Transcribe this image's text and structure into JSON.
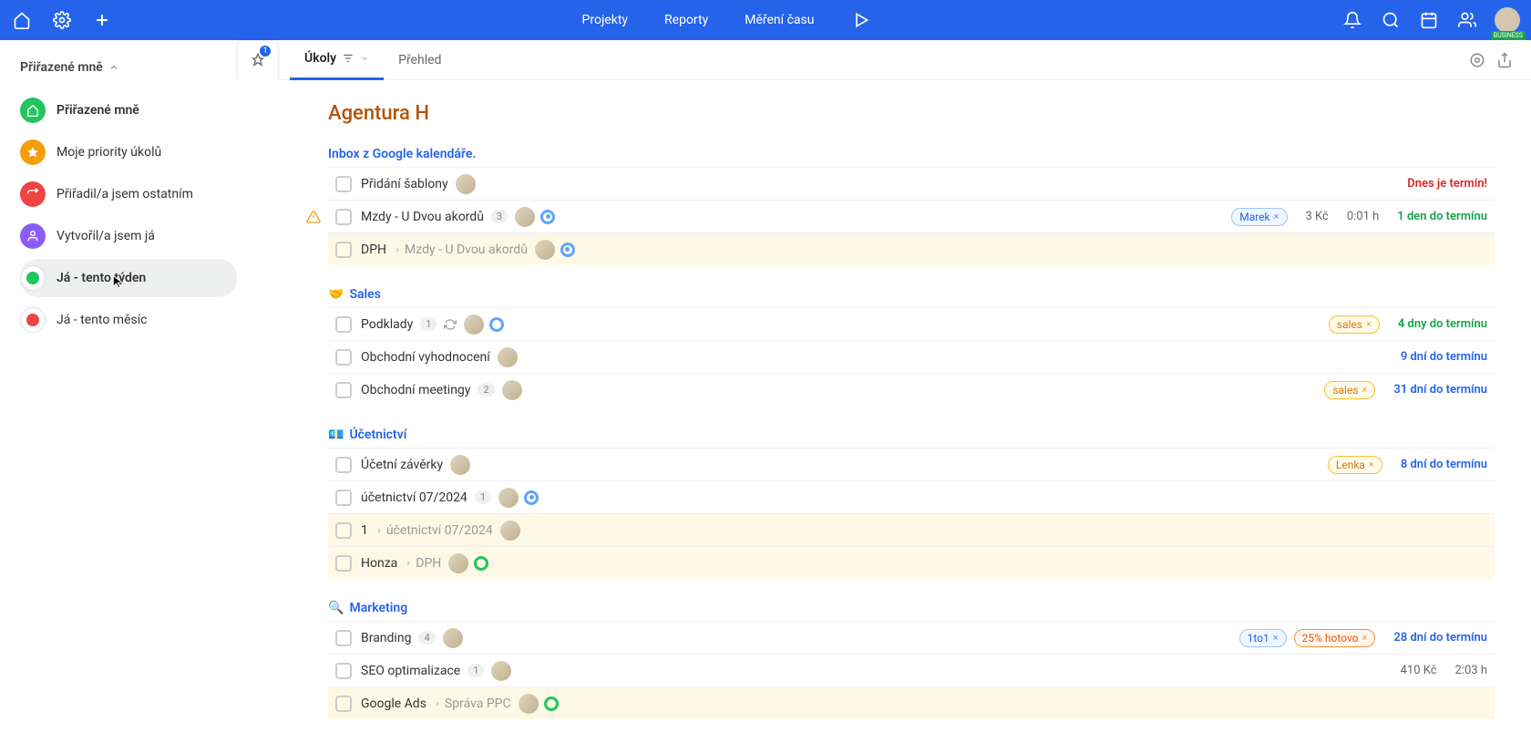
{
  "topbar": {
    "nav": {
      "projekty": "Projekty",
      "reporty": "Reporty",
      "mereni": "Měření času"
    },
    "badge": "BUSINESS"
  },
  "sidebar": {
    "header": "Přiřazené mně",
    "items": [
      {
        "label": "Přiřazené mně"
      },
      {
        "label": "Moje priority úkolů"
      },
      {
        "label": "Přiřadil/a jsem ostatním"
      },
      {
        "label": "Vytvořil/a jsem já"
      },
      {
        "label": "Já - tento týden"
      },
      {
        "label": "Já - tento měsíc"
      }
    ]
  },
  "tabs": {
    "pinCount": "1",
    "ukoly": "Úkoly",
    "prehled": "Přehled"
  },
  "project": {
    "title": "Agentura H"
  },
  "sections": [
    {
      "title": "Inbox z Google kalendáře.",
      "emoji": "",
      "tasks": [
        {
          "name": "Přidání šablony",
          "due": "Dnes je termín!",
          "dueClass": "red",
          "avatar": true
        },
        {
          "name": "Mzdy - U Dvou akordů",
          "count": "3",
          "avatar": true,
          "ringDot": true,
          "warn": true,
          "tags": [
            {
              "text": "Marek",
              "cls": "marek"
            }
          ],
          "meta1": "3 Kč",
          "meta2": "0:01 h",
          "due": "1 den do termínu",
          "dueClass": "green"
        },
        {
          "name": "DPH",
          "breadcrumb": "Mzdy - U Dvou akordů",
          "avatar": true,
          "ringDot": true,
          "highlight": true
        }
      ]
    },
    {
      "title": "Sales",
      "emoji": "🤝",
      "tasks": [
        {
          "name": "Podklady",
          "count": "1",
          "refresh": true,
          "avatar": true,
          "ring": true,
          "tags": [
            {
              "text": "sales",
              "cls": "sales"
            }
          ],
          "due": "4 dny do termínu",
          "dueClass": "green"
        },
        {
          "name": "Obchodní vyhodnocení",
          "avatar": true,
          "due": "9 dní do termínu",
          "dueClass": "blue"
        },
        {
          "name": "Obchodní meetingy",
          "count": "2",
          "avatar": true,
          "tags": [
            {
              "text": "sales",
              "cls": "sales"
            }
          ],
          "due": "31 dní do termínu",
          "dueClass": "blue"
        }
      ]
    },
    {
      "title": "Účetnictví",
      "emoji": "💶",
      "tasks": [
        {
          "name": "Účetní závěrky",
          "avatar": true,
          "tags": [
            {
              "text": "Lenka",
              "cls": "lenka"
            }
          ],
          "due": "8 dní do termínu",
          "dueClass": "blue"
        },
        {
          "name": "účetnictví 07/2024",
          "count": "1",
          "avatar": true,
          "ringDot": true
        },
        {
          "name": "1",
          "breadcrumb": "účetnictví 07/2024",
          "avatar": true,
          "highlight": true
        },
        {
          "name": "Honza",
          "breadcrumb": "DPH",
          "avatar": true,
          "ringGreen": true,
          "highlight": true
        }
      ]
    },
    {
      "title": "Marketing",
      "emoji": "🔍",
      "tasks": [
        {
          "name": "Branding",
          "count": "4",
          "avatar": true,
          "tags": [
            {
              "text": "1to1",
              "cls": "oneToOne"
            },
            {
              "text": "25% hotovo",
              "cls": "progress"
            }
          ],
          "due": "28 dní do termínu",
          "dueClass": "blue"
        },
        {
          "name": "SEO optimalizace",
          "count": "1",
          "avatar": true,
          "meta1": "410 Kč",
          "meta2": "2:03 h"
        },
        {
          "name": "Google Ads",
          "breadcrumb": "Správa PPC",
          "avatar": true,
          "ringGreen": true,
          "highlight": true
        }
      ]
    }
  ]
}
